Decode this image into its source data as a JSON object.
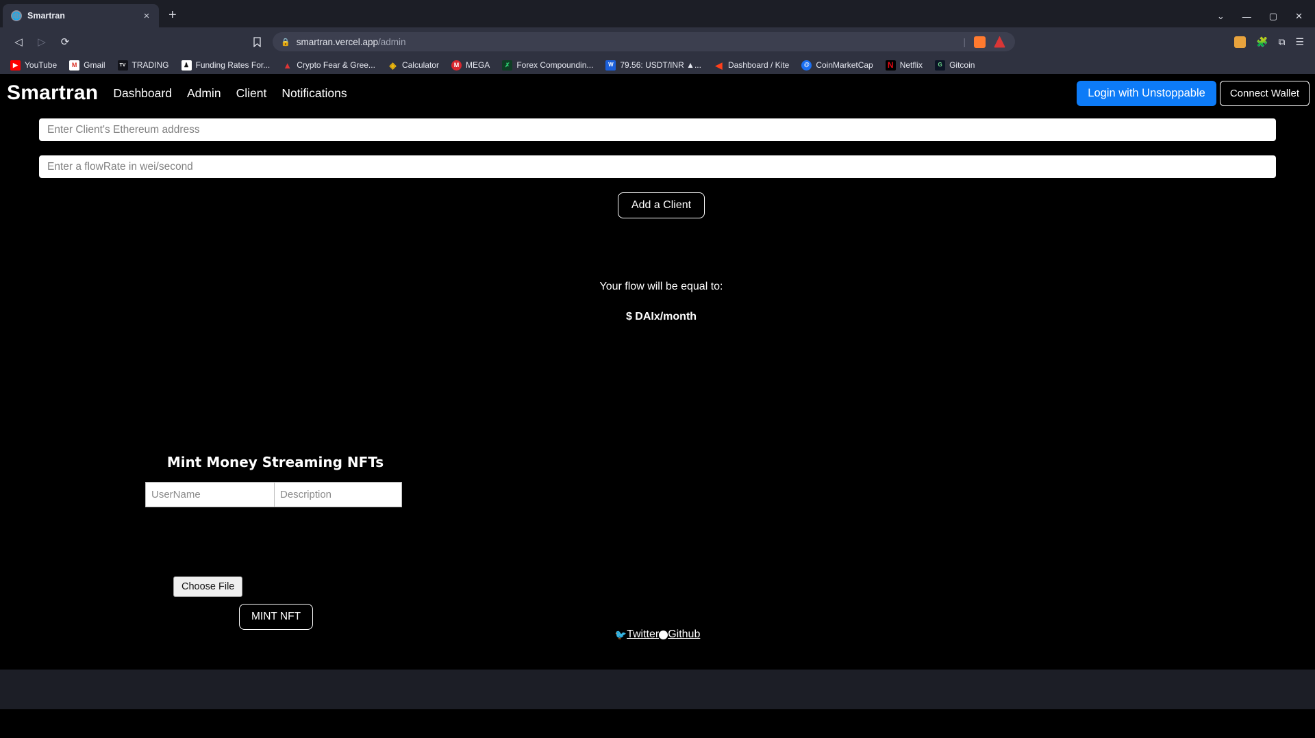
{
  "browser": {
    "tab": {
      "title": "Smartran",
      "favicon_icon": "globe-icon",
      "close_icon": "×"
    },
    "newtab_icon": "+",
    "window_controls": {
      "minimize": "—",
      "maximize": "▢",
      "close": "✕",
      "chevron": "⌄"
    },
    "nav": {
      "back_icon": "◁",
      "forward_icon": "▷",
      "reload_icon": "⟳",
      "bookmark_icon": "🔖"
    },
    "url": {
      "lock_icon": "lock-icon",
      "domain": "smartran.vercel.app",
      "path": "/admin",
      "separator": "|"
    },
    "toolbar_right": {
      "extensions_icon": "puzzle-icon",
      "split_icon": "split-view-icon",
      "menu_icon": "☰",
      "wallet_icon": "wallet-icon"
    },
    "bookmarks": [
      {
        "label": "YouTube",
        "icon": "youtube-icon",
        "color": "#ff0000",
        "glyph": "▶"
      },
      {
        "label": "Gmail",
        "icon": "gmail-icon",
        "color": "#ffffff",
        "glyph": "M"
      },
      {
        "label": "TRADING",
        "icon": "tradingview-icon",
        "color": "#1c1e26",
        "glyph": "TV"
      },
      {
        "label": "Funding Rates For...",
        "icon": "funding-rates-icon",
        "color": "#ffffff",
        "glyph": "♟"
      },
      {
        "label": "Crypto Fear & Gree...",
        "icon": "crypto-fear-greed-icon",
        "color": "#e03535",
        "glyph": "A"
      },
      {
        "label": "Calculator",
        "icon": "binance-icon",
        "color": "#f0b90b",
        "glyph": "◈"
      },
      {
        "label": "MEGA",
        "icon": "mega-icon",
        "color": "#d9272e",
        "glyph": "M"
      },
      {
        "label": "Forex Compoundin...",
        "icon": "forex-compounding-icon",
        "color": "#0f3d24",
        "glyph": "✗"
      },
      {
        "label": "79.56: USDT/INR ▲...",
        "icon": "wazirx-icon",
        "color": "#1b5fd9",
        "glyph": "W"
      },
      {
        "label": "Dashboard / Kite",
        "icon": "kite-icon",
        "color": "#ff3f1a",
        "glyph": "◀"
      },
      {
        "label": "CoinMarketCap",
        "icon": "coinmarketcap-icon",
        "color": "#1a6ff2",
        "glyph": "@"
      },
      {
        "label": "Netflix",
        "icon": "netflix-icon",
        "color": "#000000",
        "glyph": "N"
      },
      {
        "label": "Gitcoin",
        "icon": "gitcoin-icon",
        "color": "#0c1526",
        "glyph": "G"
      }
    ]
  },
  "app": {
    "brand": "Smartran",
    "nav_links": [
      "Dashboard",
      "Admin",
      "Client",
      "Notifications"
    ],
    "actions": {
      "unstoppable_label": "Login with Unstoppable",
      "connect_label": "Connect Wallet",
      "accent_color": "#0d7bf7"
    },
    "form": {
      "address_placeholder": "Enter Client's Ethereum address",
      "address_value": "",
      "flowrate_placeholder": "Enter a flowRate in wei/second",
      "flowrate_value": "",
      "add_client_label": "Add a Client"
    },
    "flow": {
      "label": "Your flow will be equal to:",
      "value": "$ DAIx/month"
    },
    "mint": {
      "title": "Mint Money Streaming NFTs",
      "username_placeholder": "UserName",
      "username_value": "",
      "description_placeholder": "Description",
      "description_value": "",
      "choose_file_label": "Choose File",
      "mint_label": "MINT NFT"
    },
    "footer": {
      "twitter_label": "Twitter",
      "github_label": "Github",
      "twitter_icon": "twitter-bird-icon",
      "github_icon": "github-icon"
    }
  }
}
